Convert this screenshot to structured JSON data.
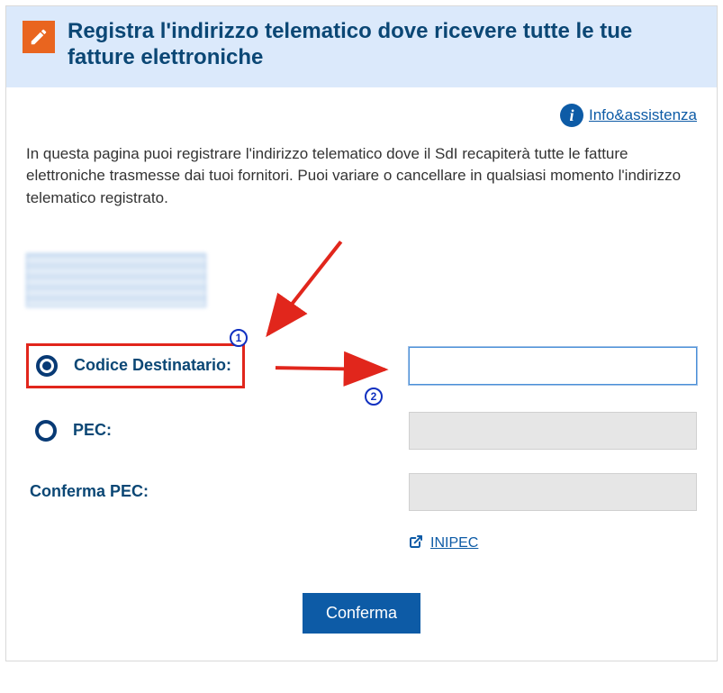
{
  "header": {
    "icon": "pencil-icon",
    "title": "Registra l'indirizzo telematico dove ricevere tutte le tue fatture elettroniche"
  },
  "help_link": {
    "label": "Info&assistenza"
  },
  "intro_text": "In questa pagina puoi registrare l'indirizzo telematico dove il SdI recapiterà tutte le fatture elettroniche trasmesse dai tuoi fornitori. Puoi variare o cancellare in qualsiasi momento l'indirizzo telematico registrato.",
  "form": {
    "codice_destinatario": {
      "label": "Codice Destinatario:",
      "selected": true,
      "value": ""
    },
    "pec": {
      "label": "PEC:",
      "selected": false,
      "value": ""
    },
    "conferma_pec": {
      "label": "Conferma PEC:",
      "value": ""
    },
    "inipec_link": "INIPEC",
    "submit_label": "Conferma"
  },
  "annotations": {
    "badge1": "1",
    "badge2": "2"
  },
  "colors": {
    "accent": "#0d5ba6",
    "header_bg": "#dbe9fb",
    "highlight": "#e1261c",
    "icon_bg": "#e9651f"
  }
}
